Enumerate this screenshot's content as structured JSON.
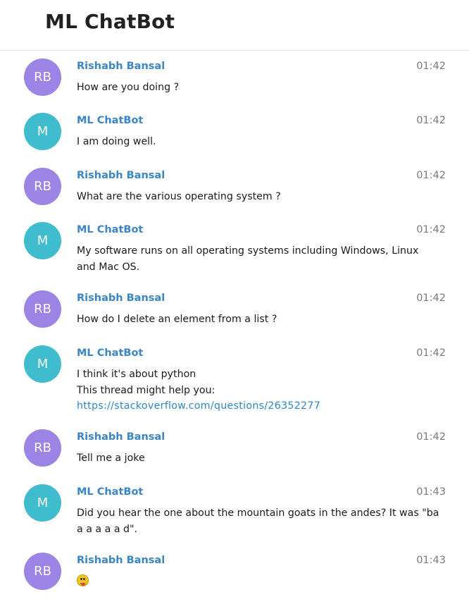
{
  "header": {
    "title": "ML ChatBot"
  },
  "colors": {
    "user_avatar": "#9b84e6",
    "bot_avatar": "#3fbccd",
    "name": "#3b86c8",
    "link": "#2e86c9",
    "time": "#7a7a7a"
  },
  "messages": [
    {
      "sender": "Rishabh Bansal",
      "initials": "RB",
      "time": "01:42",
      "lines": [
        "How are you doing ?"
      ]
    },
    {
      "sender": "ML ChatBot",
      "initials": "M",
      "time": "01:42",
      "lines": [
        "I am doing well."
      ]
    },
    {
      "sender": "Rishabh Bansal",
      "initials": "RB",
      "time": "01:42",
      "lines": [
        "What are the various operating system ?"
      ]
    },
    {
      "sender": "ML ChatBot",
      "initials": "M",
      "time": "01:42",
      "lines": [
        "My software runs on all operating systems including Windows, Linux",
        "and Mac OS."
      ]
    },
    {
      "sender": "Rishabh Bansal",
      "initials": "RB",
      "time": "01:42",
      "lines": [
        "How do I delete an element from a list ?"
      ]
    },
    {
      "sender": "ML ChatBot",
      "initials": "M",
      "time": "01:42",
      "lines": [
        "I think it's about python",
        "This thread might help you:"
      ],
      "link": "https://stackoverflow.com/questions/26352277"
    },
    {
      "sender": "Rishabh Bansal",
      "initials": "RB",
      "time": "01:42",
      "lines": [
        "Tell me a joke"
      ]
    },
    {
      "sender": "ML ChatBot",
      "initials": "M",
      "time": "01:43",
      "lines": [
        "Did you hear the one about the mountain goats in the andes? It was \"ba",
        "a a a a a d\"."
      ]
    },
    {
      "sender": "Rishabh Bansal",
      "initials": "RB",
      "time": "01:43",
      "lines": [],
      "emoji": "stuck-out-tongue-face"
    }
  ]
}
